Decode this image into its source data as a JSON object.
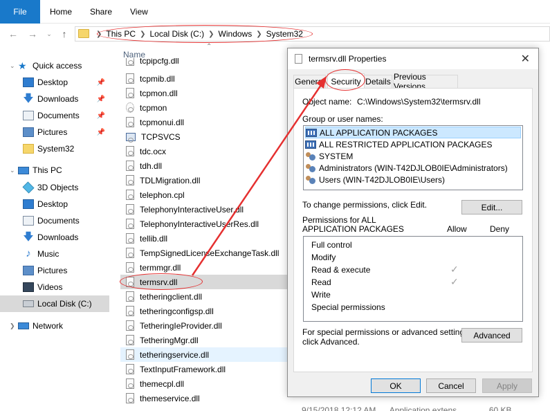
{
  "ribbon": {
    "file_label": "File",
    "tabs": [
      "Home",
      "Share",
      "View"
    ]
  },
  "address": {
    "crumbs": [
      "This PC",
      "Local Disk (C:)",
      "Windows",
      "System32"
    ]
  },
  "nav": {
    "quick_access": "Quick access",
    "quick_items": [
      "Desktop",
      "Downloads",
      "Documents",
      "Pictures",
      "System32"
    ],
    "this_pc": "This PC",
    "pc_items": [
      "3D Objects",
      "Desktop",
      "Documents",
      "Downloads",
      "Music",
      "Pictures",
      "Videos",
      "Local Disk (C:)"
    ],
    "network": "Network"
  },
  "file_list": {
    "column_name": "Name",
    "files": [
      "tcpipcfg.dll",
      "tcpmib.dll",
      "tcpmon.dll",
      "tcpmon",
      "tcpmonui.dll",
      "TCPSVCS",
      "tdc.ocx",
      "tdh.dll",
      "TDLMigration.dll",
      "telephon.cpl",
      "TelephonyInteractiveUser.dll",
      "TelephonyInteractiveUserRes.dll",
      "tellib.dll",
      "TempSignedLicenseExchangeTask.dll",
      "termmgr.dll",
      "termsrv.dll",
      "tetheringclient.dll",
      "tetheringconfigsp.dll",
      "TetheringIeProvider.dll",
      "TetheringMgr.dll",
      "tetheringservice.dll",
      "TextInputFramework.dll",
      "themecpl.dll",
      "themeservice.dll"
    ],
    "footer_partial": "9/15/2018 12:12 AM      Application extens...           60 KB"
  },
  "dialog": {
    "title": "termsrv.dll Properties",
    "close_glyph": "✕",
    "tabs": [
      "General",
      "Security",
      "Details",
      "Previous Versions"
    ],
    "object_name_label": "Object name:",
    "object_name_value": "C:\\Windows\\System32\\termsrv.dll",
    "group_label": "Group or user names:",
    "groups": [
      "ALL APPLICATION PACKAGES",
      "ALL RESTRICTED APPLICATION PACKAGES",
      "SYSTEM",
      "Administrators (WIN-T42DJLOB0IE\\Administrators)",
      "Users (WIN-T42DJLOB0IE\\Users)"
    ],
    "change_text": "To change permissions, click Edit.",
    "edit_label": "Edit...",
    "perm_for_line1": "Permissions for ALL",
    "perm_for_line2": "APPLICATION PACKAGES",
    "allow_label": "Allow",
    "deny_label": "Deny",
    "permissions": [
      {
        "name": "Full control",
        "allow": false
      },
      {
        "name": "Modify",
        "allow": false
      },
      {
        "name": "Read & execute",
        "allow": true
      },
      {
        "name": "Read",
        "allow": true
      },
      {
        "name": "Write",
        "allow": false
      },
      {
        "name": "Special permissions",
        "allow": false
      }
    ],
    "special_line1": "For special permissions or advanced settings,",
    "special_line2": "click Advanced.",
    "advanced_label": "Advanced",
    "ok_label": "OK",
    "cancel_label": "Cancel",
    "apply_label": "Apply",
    "check_glyph": "✓"
  },
  "colors": {
    "accent": "#1979ca",
    "annotation": "#e53030",
    "selection": "#cce8ff"
  }
}
